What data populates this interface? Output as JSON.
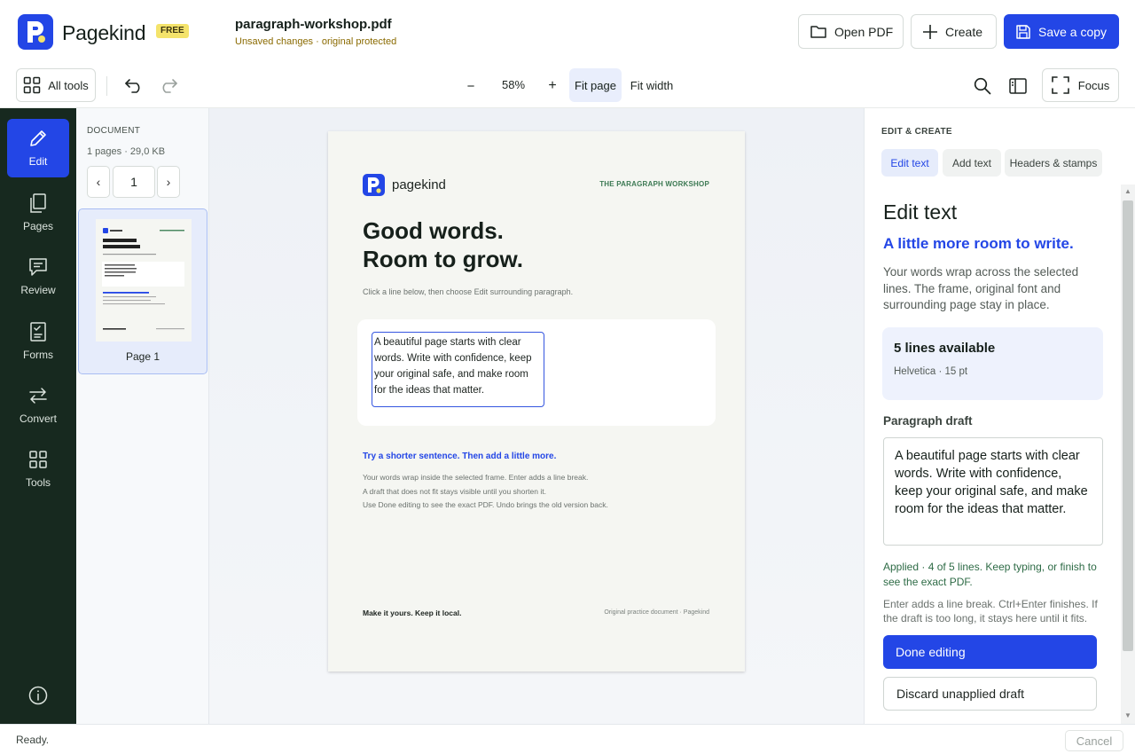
{
  "app": {
    "brand": "Pagekind",
    "badge": "FREE",
    "file_name": "paragraph-workshop.pdf",
    "file_status": "Unsaved changes · original protected",
    "accent": "#2346e6"
  },
  "header": {
    "open_pdf": "Open PDF",
    "create": "Create",
    "save_copy": "Save a copy"
  },
  "toolbar": {
    "all_tools": "All tools",
    "zoom_out": "−",
    "zoom_level": "58%",
    "zoom_in": "+",
    "fit_page": "Fit page",
    "fit_width": "Fit width",
    "focus": "Focus"
  },
  "rail": {
    "items": [
      {
        "label": "Edit",
        "icon": "pencil-icon"
      },
      {
        "label": "Pages",
        "icon": "pages-icon"
      },
      {
        "label": "Review",
        "icon": "comment-icon"
      },
      {
        "label": "Forms",
        "icon": "form-icon"
      },
      {
        "label": "Convert",
        "icon": "convert-icon"
      },
      {
        "label": "Tools",
        "icon": "grid-icon"
      }
    ]
  },
  "pages_panel": {
    "label": "DOCUMENT",
    "meta": "1 pages · 29,0 KB",
    "prev": "‹",
    "next": "›",
    "current_page": "1",
    "thumb_label": "Page 1"
  },
  "pdf": {
    "brand": "pagekind",
    "workshop": "THE PARAGRAPH WORKSHOP",
    "headline_1": "Good words.",
    "headline_2": "Room to grow.",
    "hint": "Click a line below, then choose Edit surrounding paragraph.",
    "edit_text": "A beautiful page starts with clear words. Write with confidence, keep your original safe, and make room for the ideas that matter.",
    "blue_line": "Try a shorter sentence. Then add a little more.",
    "body_1": "Your words wrap inside the selected frame. Enter adds a line break.",
    "body_2": "A draft that does not fit stays visible until you shorten it.",
    "body_3": "Use Done editing to see the exact PDF. Undo brings the old version back.",
    "footer_left": "Make it yours. Keep it local.",
    "footer_right": "Original practice document · Pagekind"
  },
  "right_panel": {
    "section": "EDIT & CREATE",
    "tabs": [
      {
        "label": "Edit text",
        "active": true
      },
      {
        "label": "Add text",
        "active": false
      },
      {
        "label": "Headers & stamps",
        "active": false
      }
    ],
    "title": "Edit text",
    "subtitle": "A little more room to write.",
    "description": "Your words wrap across the selected lines. The frame, original font and surrounding page stay in place.",
    "lines_title": "5 lines available",
    "lines_meta": "Helvetica · 15 pt",
    "draft_label": "Paragraph draft",
    "draft_value": "A beautiful page starts with clear words. Write with confidence, keep your original safe, and make room for the ideas that matter.",
    "applied": "Applied · 4 of 5 lines. Keep typing, or finish to see the exact PDF.",
    "help": "Enter adds a line break. Ctrl+Enter finishes. If the draft is too long, it stays here until it fits.",
    "done": "Done editing",
    "discard": "Discard unapplied draft"
  },
  "status": {
    "text": "Ready.",
    "cancel": "Cancel"
  }
}
